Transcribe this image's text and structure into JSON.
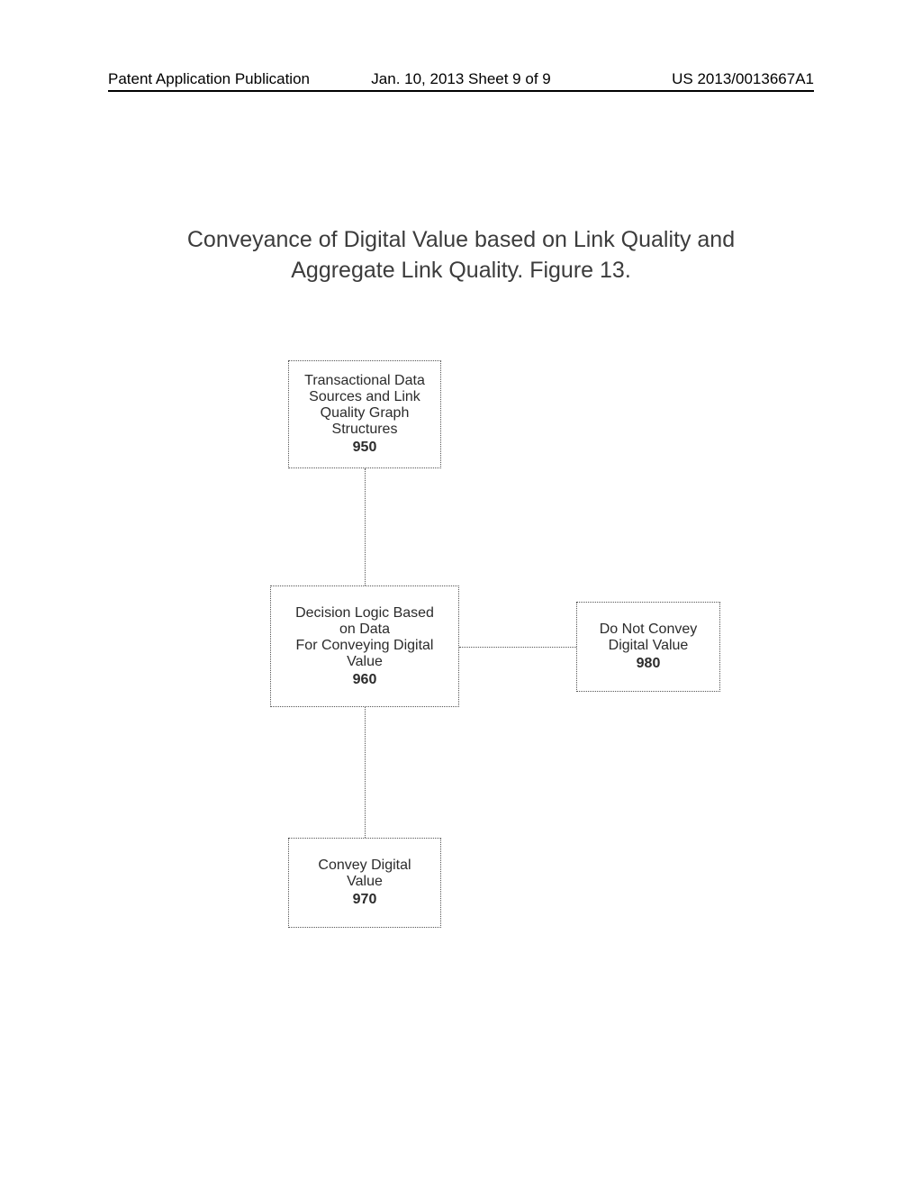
{
  "header": {
    "left": "Patent Application Publication",
    "center": "Jan. 10, 2013  Sheet 9 of 9",
    "right": "US 2013/0013667A1"
  },
  "title_line1": "Conveyance of Digital Value based on Link Quality and",
  "title_line2": "Aggregate Link Quality. Figure 13.",
  "boxes": {
    "b950": {
      "text": "Transactional Data\nSources and Link\nQuality Graph\nStructures",
      "num": "950"
    },
    "b960": {
      "text": "Decision Logic Based\non Data\nFor Conveying Digital\nValue",
      "num": "960"
    },
    "b970": {
      "text": "Convey Digital\nValue",
      "num": "970"
    },
    "b980": {
      "text": "Do Not Convey\nDigital Value",
      "num": "980"
    }
  }
}
